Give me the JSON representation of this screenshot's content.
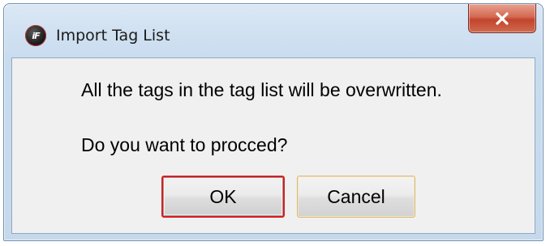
{
  "window": {
    "title": "Import Tag List",
    "app_icon": "app-logo-icon",
    "close_icon": "close-icon"
  },
  "dialog": {
    "message_line_1": "All the tags in the tag list will be overwritten.",
    "message_line_2": "Do you want to procced?"
  },
  "buttons": {
    "ok_label": "OK",
    "cancel_label": "Cancel"
  },
  "colors": {
    "ok_focus_border": "#e0191b",
    "close_button": "#c2452c",
    "client_background": "#f0f0f0"
  }
}
